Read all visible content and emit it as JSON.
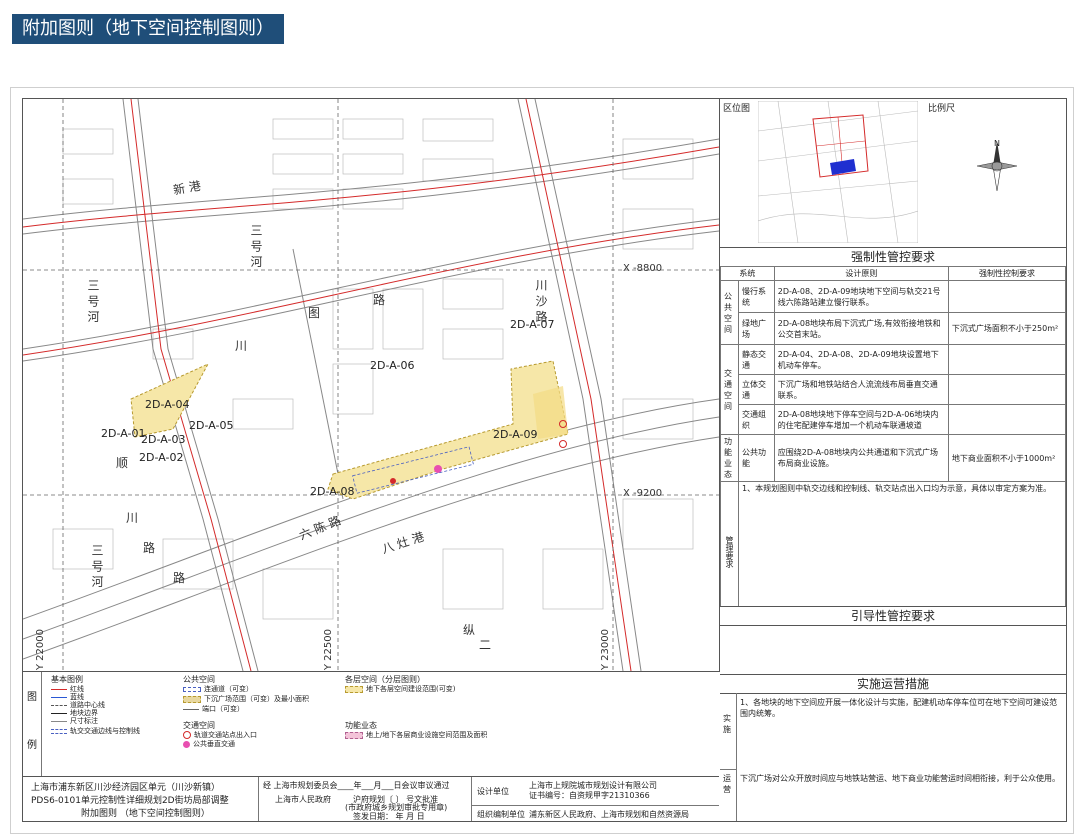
{
  "header": {
    "title": "附加图则（地下空间控制图则）"
  },
  "map": {
    "parcels": [
      "2D-A-07",
      "2D-A-06",
      "2D-A-04",
      "2D-A-05",
      "2D-A-01",
      "2D-A-03",
      "2D-A-02",
      "2D-A-09",
      "2D-A-08"
    ],
    "roads": {
      "xingang": "新 港",
      "sanhaohe_top": "三 号 河",
      "chuansha_lu": "川 沙 路",
      "tu": "图",
      "lu": "路",
      "chuan": "川",
      "sanhaohe_left": "三 号 河",
      "shun": "顺",
      "chuan2": "川",
      "lu2": "路",
      "liuchen_lu": "六 陈 路",
      "bazaogang": "八 灶 港",
      "zong": "纵",
      "er": "二",
      "sanhaohe_bottom": "三 号 河",
      "lu3": "路"
    },
    "coords": {
      "x8800": "X -8800",
      "x9200": "X -9200",
      "y22000": "Y 22000",
      "y22500": "Y 22500",
      "y23000": "Y 23000"
    }
  },
  "right": {
    "keymap_label": "区位图",
    "scale_label": "比例尺",
    "north_label": "N",
    "mandatory_title": "强制性管控要求",
    "table_headers": [
      "系统",
      "设计原则",
      "强制性控制要求"
    ],
    "rows": [
      {
        "group": "公共空间",
        "sub": "慢行系统",
        "principle": "2D-A-08、2D-A-09地块地下空间与轨交21号线六陈路站建立慢行联系。",
        "req": ""
      },
      {
        "group": "",
        "sub": "绿地广场",
        "principle": "2D-A-08地块布局下沉式广场,有效衔接地铁和公交首末站。",
        "req": "下沉式广场面积不小于250m²"
      },
      {
        "group": "交通空间",
        "sub": "静态交通",
        "principle": "2D-A-04、2D-A-08、2D-A-09地块设置地下机动车停车。",
        "req": ""
      },
      {
        "group": "",
        "sub": "立体交通",
        "principle": "下沉广场和地铁站结合人流流线布局垂直交通联系。",
        "req": ""
      },
      {
        "group": "",
        "sub": "交通组织",
        "principle": "2D-A-08地块地下停车空间与2D-A-06地块内的住宅配建停车增加一个机动车联通坡道",
        "req": ""
      },
      {
        "group": "功能业态",
        "sub": "公共功能",
        "principle": "应围绕2D-A-08地块内公共通道和下沉式广场布局商业设施。",
        "req": "地下商业面积不小于1000m²"
      }
    ],
    "mgmt_group": "管理要求",
    "mgmt_text": "1、本规划图则中轨交边线和控制线、轨交站点出入口均为示意，具体以审定方案为准。",
    "guide_title": "引导性管控要求",
    "impl_title": "实施运营措施",
    "impl_group": "实施",
    "impl_text": "1、各地块的地下空间应开展一体化设计与实施，配建机动车停车位可在地下空间可建设范围内统筹。",
    "ops_group": "运营",
    "ops_text": "下沉广场对公众开放时间应与地铁站营运、地下商业功能营运时间相衔接，利于公众使用。"
  },
  "legend": {
    "vert": [
      "图",
      "例"
    ],
    "basic_title": "基本图例",
    "basic_items": [
      "红线",
      "蓝线",
      "道路中心线",
      "地块边界",
      "尺寸标注",
      "轨交交通边线与控制线"
    ],
    "public_title": "公共空间",
    "public_items": [
      "连通道（可变）",
      "下沉广场范围（可变）及最小面积",
      "端口（可变）"
    ],
    "traffic_title": "交通空间",
    "traffic_items": [
      "轨道交通站点出入口",
      "公共垂直交通"
    ],
    "layer_title": "各层空间（分层图则）",
    "layer_items": [
      "地下各层空间建设范围(可变)"
    ],
    "func_title": "功能业态",
    "func_items": [
      "地上/地下各层商业设施空间范围及面积"
    ]
  },
  "titleblock": {
    "line1": "上海市浦东新区川沙经济园区单元（川沙新镇）",
    "line2": "PDS6-0101单元控制性详细规划2D街坊局部调整",
    "line3": "附加图则 （地下空间控制图则）",
    "approve1": "经  上海市规划委员会____年___月___日会议审议通过",
    "approve2": "上海市人民政府",
    "approve3": "沪府规划〔      〕    号文批准",
    "approve4": "(市政府城乡规划审批专用章)",
    "approve5": "签发日期：      年      月      日",
    "design_label": "设计单位",
    "design_unit": "上海市上规院城市规划设计有限公司",
    "cert": "证书编号：自资规甲字21310366",
    "org_label": "组织编制单位",
    "org_unit": "浦东新区人民政府、上海市规划和自然资源局"
  },
  "colors": {
    "header_bg": "#1f4e79",
    "parcel_fill": "#f6e7a8",
    "red_line": "#d42a2a",
    "keymap_blue": "#1f2fd0"
  }
}
